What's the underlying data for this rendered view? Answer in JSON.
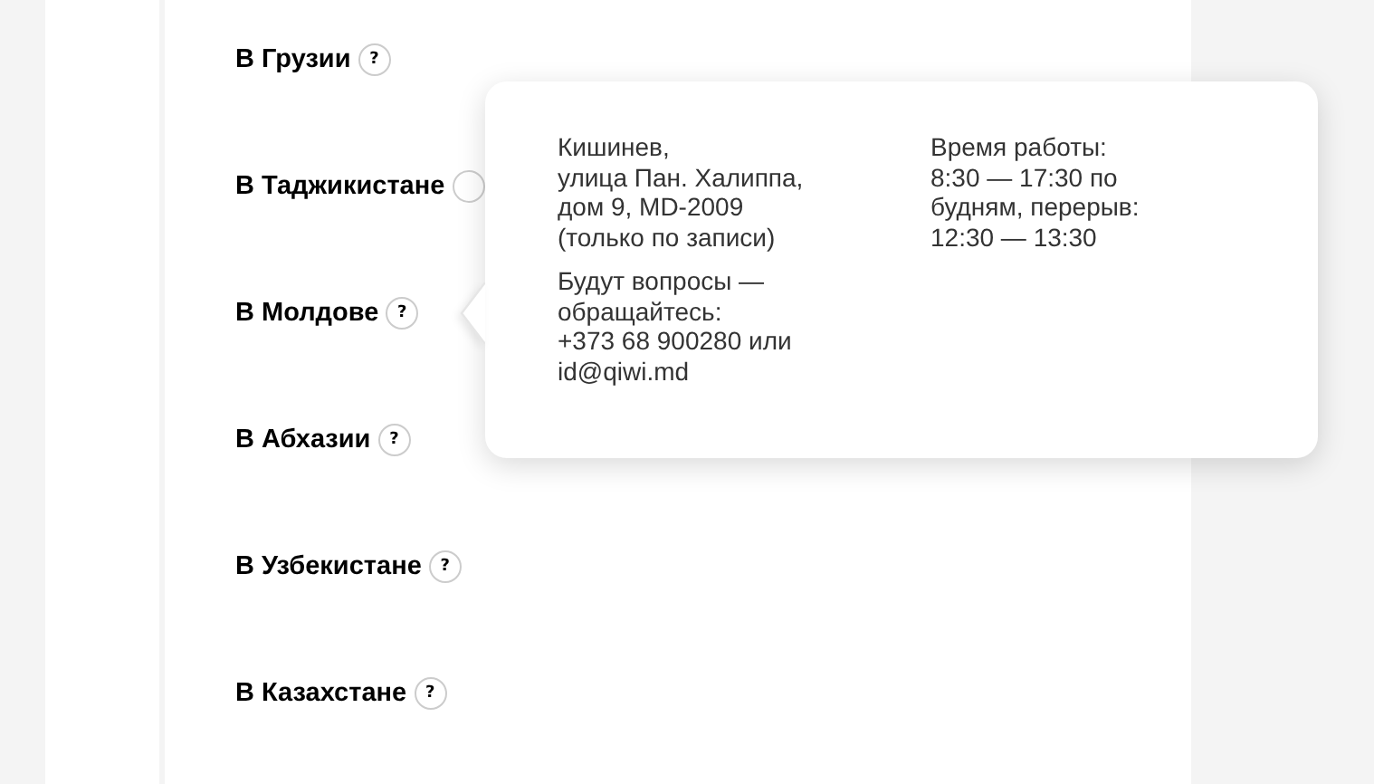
{
  "countries": [
    {
      "name": "В Грузии",
      "help": "?"
    },
    {
      "name": "В Таджикистане"
    },
    {
      "name": "В Молдове",
      "help": "?",
      "tooltip": {
        "address": [
          "Кишинев,",
          "улица Пан. Халиппа,",
          "дом 9, MD-2009",
          "(только по записи)"
        ],
        "contact": [
          "Будут вопросы —",
          "обращайтесь:",
          "+373 68 900280 или",
          "id@qiwi.md"
        ],
        "hours": [
          "Время работы:",
          "8:30 — 17:30 по",
          "будням, перерыв:",
          "12:30 — 13:30"
        ]
      }
    },
    {
      "name": "В Абхазии",
      "help": "?"
    },
    {
      "name": "В Узбекистане",
      "help": "?"
    },
    {
      "name": "В Казахстане",
      "help": "?"
    }
  ]
}
